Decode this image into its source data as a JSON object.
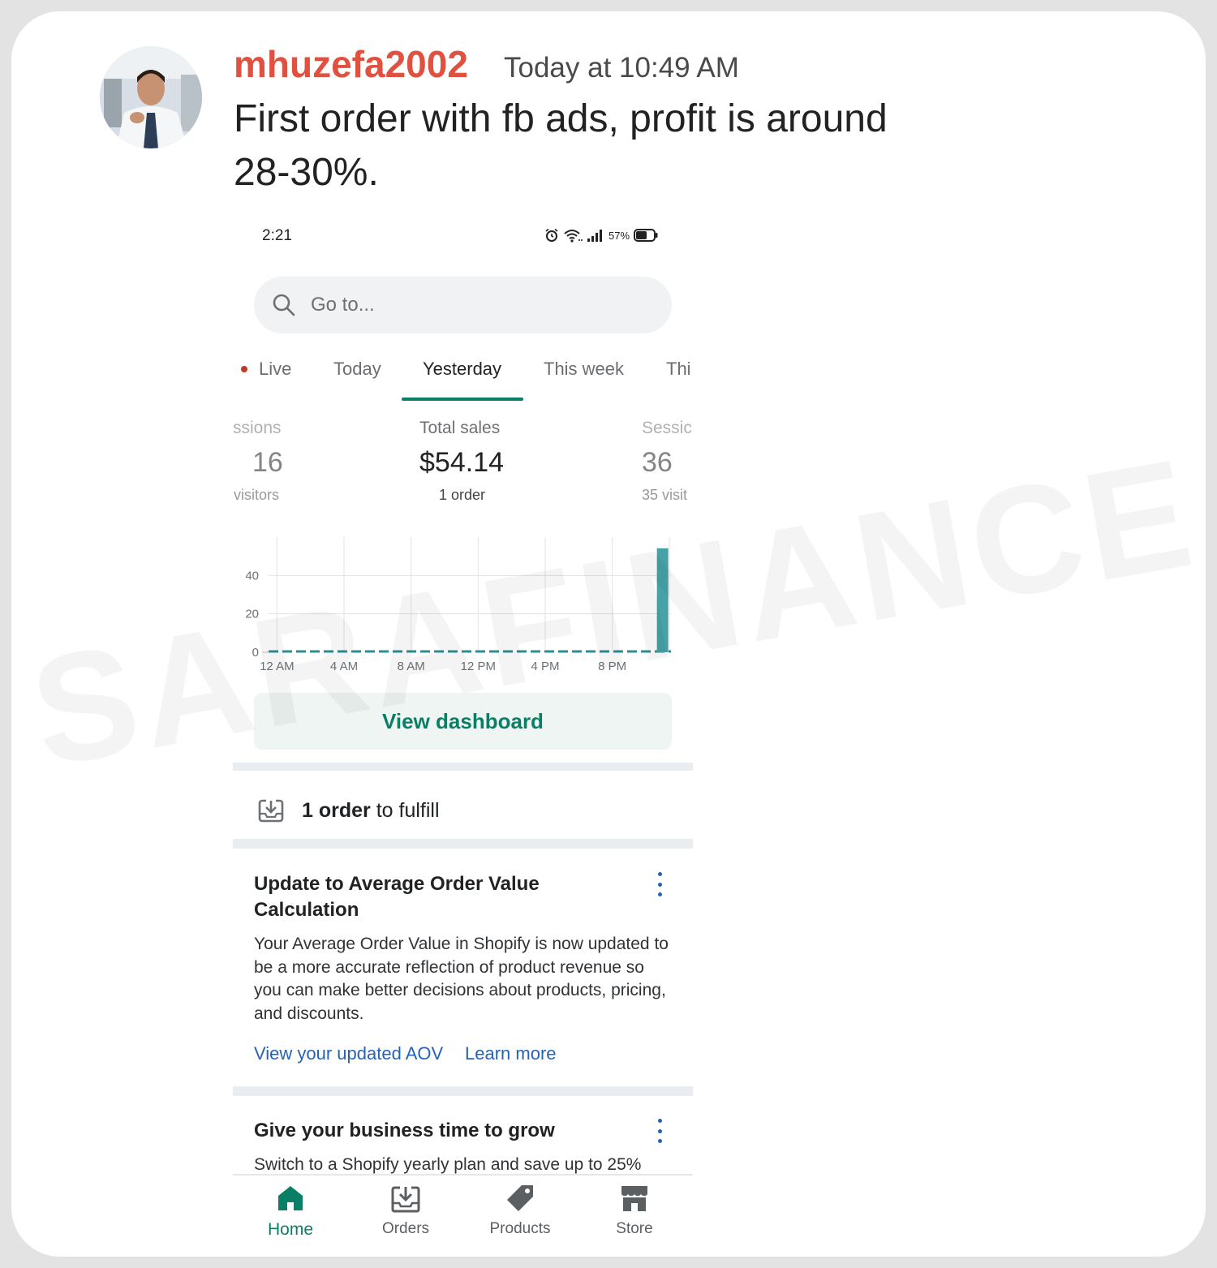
{
  "post": {
    "username": "mhuzefa2002",
    "timestamp": "Today at 10:49 AM",
    "message": "First order with fb ads, profit is around 28-30%."
  },
  "phone": {
    "status_bar": {
      "time": "2:21",
      "battery": "57%"
    },
    "search": {
      "placeholder": "Go to..."
    },
    "tabs": [
      "Live",
      "Today",
      "Yesterday",
      "This week",
      "Thi"
    ],
    "active_tab": "Yesterday",
    "metrics": {
      "left": {
        "label": "ssions",
        "value": "16",
        "sub": "visitors"
      },
      "center": {
        "label": "Total sales",
        "value": "$54.14",
        "sub": "1 order"
      },
      "right": {
        "label": "Sessic",
        "value": "36",
        "sub": "35 visit"
      }
    },
    "chart_data": {
      "type": "bar",
      "categories": [
        "12 AM",
        "1 AM",
        "2 AM",
        "3 AM",
        "4 AM",
        "5 AM",
        "6 AM",
        "7 AM",
        "8 AM",
        "9 AM",
        "10 AM",
        "11 AM",
        "12 PM",
        "1 PM",
        "2 PM",
        "3 PM",
        "4 PM",
        "5 PM",
        "6 PM",
        "7 PM",
        "8 PM",
        "9 PM",
        "10 PM",
        "11 PM"
      ],
      "values": [
        0,
        0,
        0,
        0,
        0,
        0,
        0,
        0,
        0,
        0,
        0,
        0,
        0,
        0,
        0,
        0,
        0,
        0,
        0,
        0,
        0,
        0,
        0,
        54.14
      ],
      "x_tick_labels": [
        "12 AM",
        "4 AM",
        "8 AM",
        "12 PM",
        "4 PM",
        "8 PM"
      ],
      "y_tick_labels": [
        "0",
        "20",
        "40"
      ],
      "ylim": [
        0,
        60
      ],
      "grid": true,
      "bar_color": "#47a2a8",
      "zero_line_color": "#2f8e95"
    },
    "dashboard_button": "View dashboard",
    "fulfill": {
      "count_text": "1 order",
      "rest_text": " to fulfill"
    },
    "cards": [
      {
        "title": "Update to Average Order Value Calculation",
        "body": "Your Average Order Value in Shopify is now updated to be a more accurate reflection of product revenue so you can make better decisions about products, pricing, and discounts.",
        "links": [
          "View your updated AOV",
          "Learn more"
        ]
      },
      {
        "title": "Give your business time to grow",
        "body": "Switch to a Shopify yearly plan and save up to 25%"
      }
    ],
    "nav": [
      {
        "label": "Home",
        "icon": "home-icon"
      },
      {
        "label": "Orders",
        "icon": "orders-icon"
      },
      {
        "label": "Products",
        "icon": "tag-icon"
      },
      {
        "label": "Store",
        "icon": "store-icon"
      }
    ],
    "colors": {
      "accent": "#0a7f65",
      "link": "#2463bc",
      "username": "#e0513f"
    }
  },
  "watermark": "SARAFINANCE"
}
